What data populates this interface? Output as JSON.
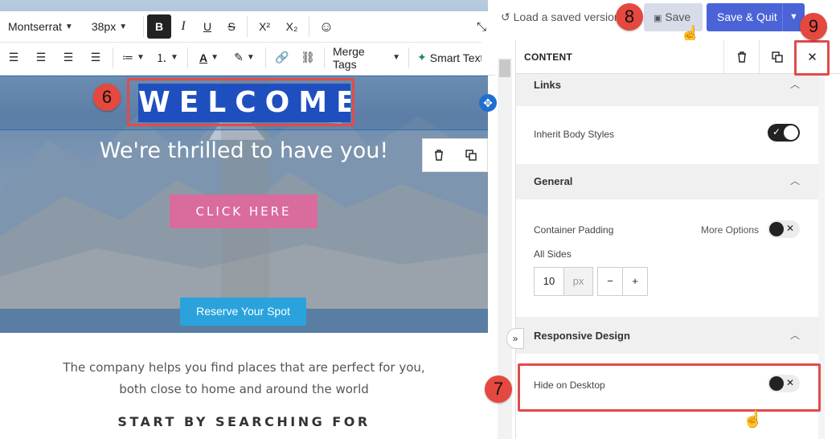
{
  "toolbar": {
    "font_family": "Montserrat",
    "font_size": "38px",
    "bold_label": "B",
    "italic_label": "I",
    "underline_label": "U",
    "strike_label": "S",
    "superscript_label": "X²",
    "subscript_label": "X₂",
    "merge_tags_label": "Merge Tags",
    "smart_text_label": "Smart Text"
  },
  "hero": {
    "title": "WELCOME",
    "subtitle": "We're thrilled to have you!",
    "cta_label": "CLICK HERE",
    "reserve_label": "Reserve Your Spot"
  },
  "body": {
    "line1": "The company helps you find places that are perfect for you,",
    "line2": "both close to home and around the world",
    "heading": "START BY SEARCHING FOR"
  },
  "topbar": {
    "load_saved": "Load a saved version",
    "save_label": "Save",
    "save_quit_label": "Save & Quit"
  },
  "panel": {
    "title": "CONTENT",
    "sections": {
      "links": "Links",
      "general": "General",
      "responsive": "Responsive Design"
    },
    "inherit_body_styles": "Inherit Body Styles",
    "container_padding": "Container Padding",
    "more_options": "More Options",
    "all_sides": "All Sides",
    "padding_value": "10",
    "padding_unit": "px",
    "minus": "−",
    "plus": "+",
    "hide_on_desktop": "Hide on Desktop"
  },
  "callouts": {
    "b6": "6",
    "b7": "7",
    "b8": "8",
    "b9": "9"
  },
  "colors": {
    "accent": "#4a63d6",
    "callout": "#e5483f",
    "cta": "#d96b9d",
    "reserve": "#2aa3dd"
  }
}
